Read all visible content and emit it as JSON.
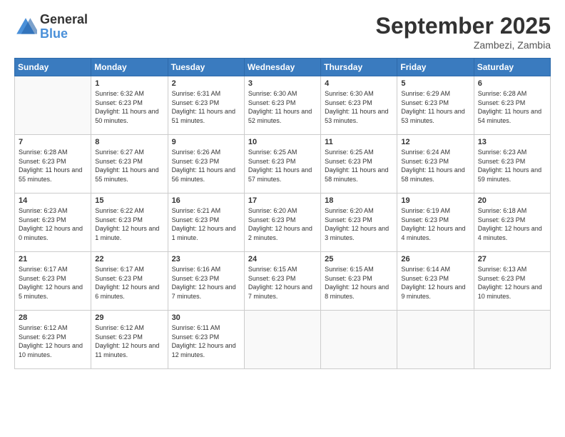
{
  "logo": {
    "general": "General",
    "blue": "Blue"
  },
  "title": "September 2025",
  "location": "Zambezi, Zambia",
  "days_of_week": [
    "Sunday",
    "Monday",
    "Tuesday",
    "Wednesday",
    "Thursday",
    "Friday",
    "Saturday"
  ],
  "weeks": [
    [
      {
        "day": "",
        "sunrise": "",
        "sunset": "",
        "daylight": ""
      },
      {
        "day": "1",
        "sunrise": "Sunrise: 6:32 AM",
        "sunset": "Sunset: 6:23 PM",
        "daylight": "Daylight: 11 hours and 50 minutes."
      },
      {
        "day": "2",
        "sunrise": "Sunrise: 6:31 AM",
        "sunset": "Sunset: 6:23 PM",
        "daylight": "Daylight: 11 hours and 51 minutes."
      },
      {
        "day": "3",
        "sunrise": "Sunrise: 6:30 AM",
        "sunset": "Sunset: 6:23 PM",
        "daylight": "Daylight: 11 hours and 52 minutes."
      },
      {
        "day": "4",
        "sunrise": "Sunrise: 6:30 AM",
        "sunset": "Sunset: 6:23 PM",
        "daylight": "Daylight: 11 hours and 53 minutes."
      },
      {
        "day": "5",
        "sunrise": "Sunrise: 6:29 AM",
        "sunset": "Sunset: 6:23 PM",
        "daylight": "Daylight: 11 hours and 53 minutes."
      },
      {
        "day": "6",
        "sunrise": "Sunrise: 6:28 AM",
        "sunset": "Sunset: 6:23 PM",
        "daylight": "Daylight: 11 hours and 54 minutes."
      }
    ],
    [
      {
        "day": "7",
        "sunrise": "Sunrise: 6:28 AM",
        "sunset": "Sunset: 6:23 PM",
        "daylight": "Daylight: 11 hours and 55 minutes."
      },
      {
        "day": "8",
        "sunrise": "Sunrise: 6:27 AM",
        "sunset": "Sunset: 6:23 PM",
        "daylight": "Daylight: 11 hours and 55 minutes."
      },
      {
        "day": "9",
        "sunrise": "Sunrise: 6:26 AM",
        "sunset": "Sunset: 6:23 PM",
        "daylight": "Daylight: 11 hours and 56 minutes."
      },
      {
        "day": "10",
        "sunrise": "Sunrise: 6:25 AM",
        "sunset": "Sunset: 6:23 PM",
        "daylight": "Daylight: 11 hours and 57 minutes."
      },
      {
        "day": "11",
        "sunrise": "Sunrise: 6:25 AM",
        "sunset": "Sunset: 6:23 PM",
        "daylight": "Daylight: 11 hours and 58 minutes."
      },
      {
        "day": "12",
        "sunrise": "Sunrise: 6:24 AM",
        "sunset": "Sunset: 6:23 PM",
        "daylight": "Daylight: 11 hours and 58 minutes."
      },
      {
        "day": "13",
        "sunrise": "Sunrise: 6:23 AM",
        "sunset": "Sunset: 6:23 PM",
        "daylight": "Daylight: 11 hours and 59 minutes."
      }
    ],
    [
      {
        "day": "14",
        "sunrise": "Sunrise: 6:23 AM",
        "sunset": "Sunset: 6:23 PM",
        "daylight": "Daylight: 12 hours and 0 minutes."
      },
      {
        "day": "15",
        "sunrise": "Sunrise: 6:22 AM",
        "sunset": "Sunset: 6:23 PM",
        "daylight": "Daylight: 12 hours and 1 minute."
      },
      {
        "day": "16",
        "sunrise": "Sunrise: 6:21 AM",
        "sunset": "Sunset: 6:23 PM",
        "daylight": "Daylight: 12 hours and 1 minute."
      },
      {
        "day": "17",
        "sunrise": "Sunrise: 6:20 AM",
        "sunset": "Sunset: 6:23 PM",
        "daylight": "Daylight: 12 hours and 2 minutes."
      },
      {
        "day": "18",
        "sunrise": "Sunrise: 6:20 AM",
        "sunset": "Sunset: 6:23 PM",
        "daylight": "Daylight: 12 hours and 3 minutes."
      },
      {
        "day": "19",
        "sunrise": "Sunrise: 6:19 AM",
        "sunset": "Sunset: 6:23 PM",
        "daylight": "Daylight: 12 hours and 4 minutes."
      },
      {
        "day": "20",
        "sunrise": "Sunrise: 6:18 AM",
        "sunset": "Sunset: 6:23 PM",
        "daylight": "Daylight: 12 hours and 4 minutes."
      }
    ],
    [
      {
        "day": "21",
        "sunrise": "Sunrise: 6:17 AM",
        "sunset": "Sunset: 6:23 PM",
        "daylight": "Daylight: 12 hours and 5 minutes."
      },
      {
        "day": "22",
        "sunrise": "Sunrise: 6:17 AM",
        "sunset": "Sunset: 6:23 PM",
        "daylight": "Daylight: 12 hours and 6 minutes."
      },
      {
        "day": "23",
        "sunrise": "Sunrise: 6:16 AM",
        "sunset": "Sunset: 6:23 PM",
        "daylight": "Daylight: 12 hours and 7 minutes."
      },
      {
        "day": "24",
        "sunrise": "Sunrise: 6:15 AM",
        "sunset": "Sunset: 6:23 PM",
        "daylight": "Daylight: 12 hours and 7 minutes."
      },
      {
        "day": "25",
        "sunrise": "Sunrise: 6:15 AM",
        "sunset": "Sunset: 6:23 PM",
        "daylight": "Daylight: 12 hours and 8 minutes."
      },
      {
        "day": "26",
        "sunrise": "Sunrise: 6:14 AM",
        "sunset": "Sunset: 6:23 PM",
        "daylight": "Daylight: 12 hours and 9 minutes."
      },
      {
        "day": "27",
        "sunrise": "Sunrise: 6:13 AM",
        "sunset": "Sunset: 6:23 PM",
        "daylight": "Daylight: 12 hours and 10 minutes."
      }
    ],
    [
      {
        "day": "28",
        "sunrise": "Sunrise: 6:12 AM",
        "sunset": "Sunset: 6:23 PM",
        "daylight": "Daylight: 12 hours and 10 minutes."
      },
      {
        "day": "29",
        "sunrise": "Sunrise: 6:12 AM",
        "sunset": "Sunset: 6:23 PM",
        "daylight": "Daylight: 12 hours and 11 minutes."
      },
      {
        "day": "30",
        "sunrise": "Sunrise: 6:11 AM",
        "sunset": "Sunset: 6:23 PM",
        "daylight": "Daylight: 12 hours and 12 minutes."
      },
      {
        "day": "",
        "sunrise": "",
        "sunset": "",
        "daylight": ""
      },
      {
        "day": "",
        "sunrise": "",
        "sunset": "",
        "daylight": ""
      },
      {
        "day": "",
        "sunrise": "",
        "sunset": "",
        "daylight": ""
      },
      {
        "day": "",
        "sunrise": "",
        "sunset": "",
        "daylight": ""
      }
    ]
  ]
}
